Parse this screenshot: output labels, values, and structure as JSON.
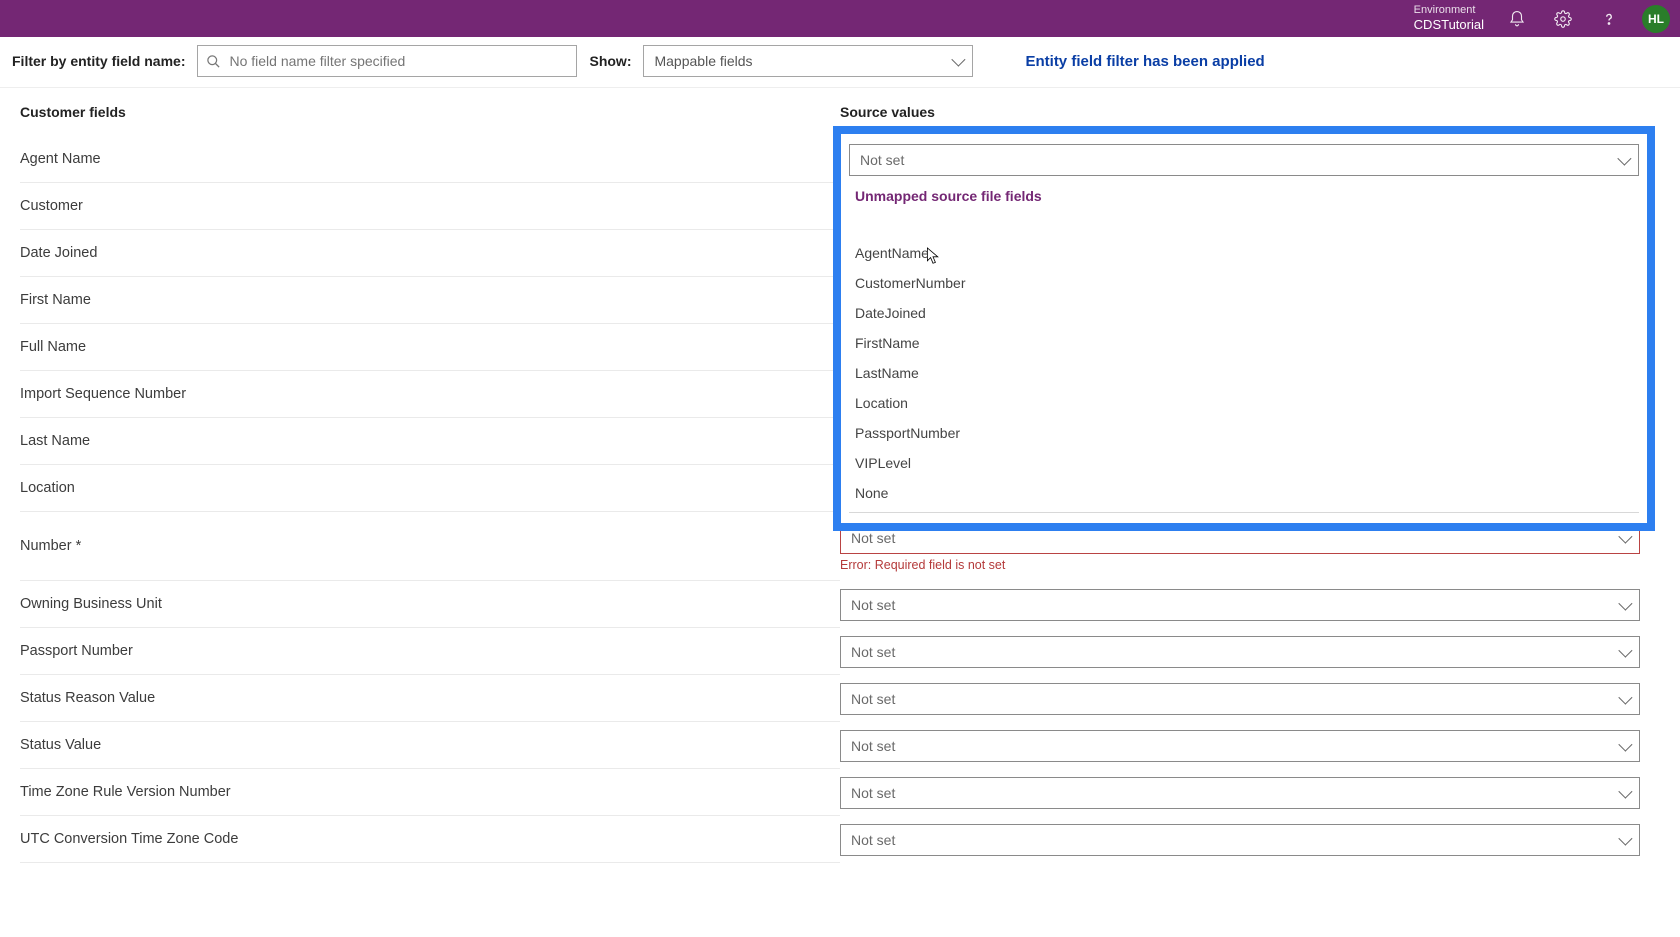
{
  "header": {
    "env_label": "Environment",
    "env_name": "CDSTutorial",
    "avatar_initials": "HL"
  },
  "filter": {
    "filter_label": "Filter by entity field name:",
    "filter_placeholder": "No field name filter specified",
    "show_label": "Show:",
    "show_value": "Mappable fields",
    "applied_msg": "Entity field filter has been applied"
  },
  "columns": {
    "left_header": "Customer fields",
    "right_header": "Source values"
  },
  "not_set": "Not set",
  "error_text": "Error: Required field is not set",
  "customer_fields": [
    "Agent Name",
    "Customer",
    "Date Joined",
    "First Name",
    "Full Name",
    "Import Sequence Number",
    "Last Name",
    "Location",
    "Number *",
    "Owning Business Unit",
    "Passport Number",
    "Status Reason Value",
    "Status Value",
    "Time Zone Rule Version Number",
    "UTC Conversion Time Zone Code"
  ],
  "dropdown": {
    "header": "Unmapped source file fields",
    "options": [
      "AgentName",
      "CustomerNumber",
      "DateJoined",
      "FirstName",
      "LastName",
      "Location",
      "PassportNumber",
      "VIPLevel",
      "None"
    ]
  }
}
